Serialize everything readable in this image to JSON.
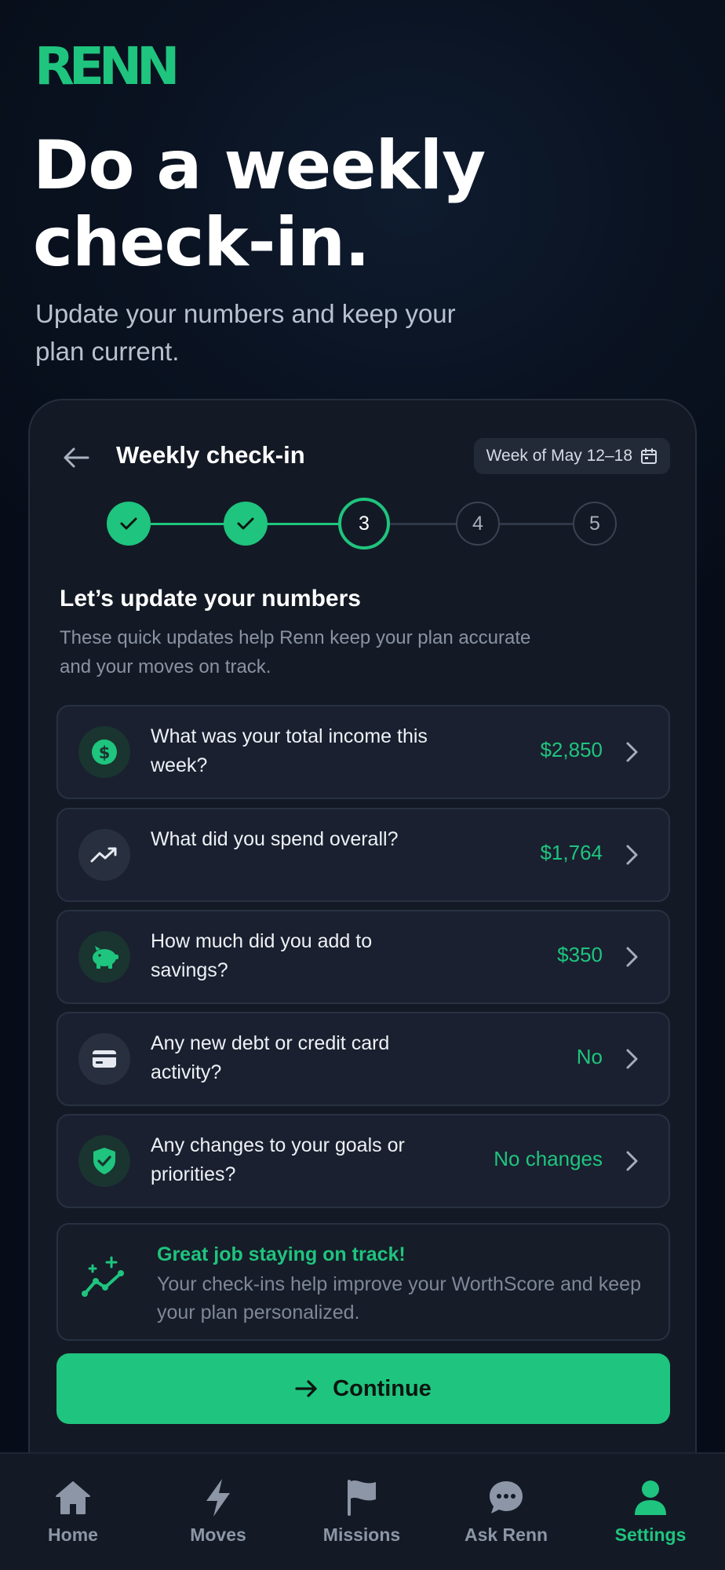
{
  "app": {
    "logo": "RENN",
    "hero_title": "Do a weekly check-in.",
    "hero_subtitle": "Update your numbers and keep your plan current."
  },
  "card": {
    "title": "Weekly check-in",
    "week_label": "Week of May 12–18",
    "stepper": {
      "current_step": 3,
      "total_steps": 5,
      "steps": [
        "1",
        "2",
        "3",
        "4",
        "5"
      ]
    },
    "section_title": "Let’s update your numbers",
    "section_description": "These quick updates help Renn keep your plan accurate and your moves on track.",
    "questions": [
      {
        "icon": "dollar-icon",
        "label": "What was your total income this week?",
        "value": "$2,850"
      },
      {
        "icon": "trend-up-icon",
        "label": "What did you spend overall?",
        "value": "$1,764"
      },
      {
        "icon": "piggy-bank-icon",
        "label": "How much did you add to savings?",
        "value": "$350"
      },
      {
        "icon": "credit-card-icon",
        "label": "Any new debt or credit card activity?",
        "value": "No"
      },
      {
        "icon": "shield-check-icon",
        "label": "Any changes to your goals or priorities?",
        "value": "No changes"
      }
    ],
    "tip": {
      "title": "Great job staying on track!",
      "body": "Your check-ins help improve your WorthScore and keep your plan personalized."
    },
    "continue_label": "Continue"
  },
  "tabbar": {
    "active": "Settings",
    "tabs": [
      {
        "label": "Home",
        "icon": "home-icon"
      },
      {
        "label": "Moves",
        "icon": "lightning-icon"
      },
      {
        "label": "Missions",
        "icon": "flag-icon"
      },
      {
        "label": "Ask Renn",
        "icon": "chat-bubble-icon"
      },
      {
        "label": "Settings",
        "icon": "person-icon"
      }
    ]
  },
  "colors": {
    "accent": "#1fc47e",
    "background": "#0a1322",
    "card": "#141a25"
  }
}
